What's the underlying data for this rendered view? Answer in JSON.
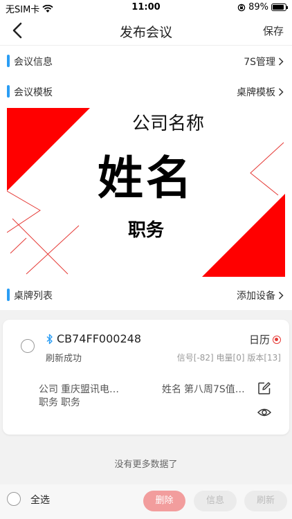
{
  "status_bar": {
    "carrier": "无SIM卡",
    "time": "11:00",
    "battery": "89%",
    "battery_level": 0.89
  },
  "nav": {
    "title": "发布会议",
    "save_label": "保存"
  },
  "sections": {
    "meeting_info": {
      "title": "会议信息",
      "link": "7S管理"
    },
    "meeting_template": {
      "title": "会议模板",
      "link": "桌牌模板"
    },
    "nameplate_list": {
      "title": "桌牌列表",
      "link": "添加设备"
    }
  },
  "template": {
    "company": "公司名称",
    "name": "姓名",
    "position": "职务",
    "accent_color": "#ff0000"
  },
  "device": {
    "id": "CB74FF000248",
    "status": "刷新成功",
    "mode": "日历",
    "meta": "信号[-82] 电量[0] 版本[13]",
    "company_label": "公司",
    "company_value": "重庆盟讯电…",
    "name_label": "姓名",
    "name_value": "第八周7S值…",
    "position_label": "职务",
    "position_value": "职务"
  },
  "footer_text": "没有更多数据了",
  "bottom": {
    "select_all": "全选",
    "delete": "删除",
    "info": "信息",
    "refresh": "刷新"
  },
  "colors": {
    "section_accent": "#2a9df4",
    "danger": "#e53935",
    "delete_button": "#f29d9d"
  }
}
